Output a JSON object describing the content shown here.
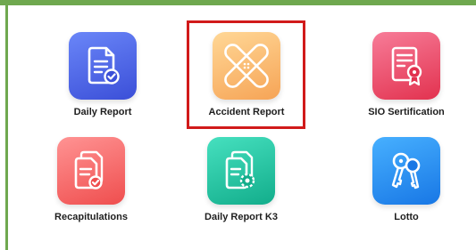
{
  "colors": {
    "frame": "#6fa84f",
    "selection": "#d11a1a"
  },
  "menu": {
    "items": [
      {
        "label": "Daily Report",
        "icon": "document-check-icon",
        "color_from": "#5f7cf6",
        "color_to": "#3b4fd8"
      },
      {
        "label": "Accident Report",
        "icon": "bandage-icon",
        "color_from": "#ffcf8a",
        "color_to": "#f7a857"
      },
      {
        "label": "SIO Sertification",
        "icon": "certificate-icon",
        "color_from": "#f4708f",
        "color_to": "#e2324f"
      },
      {
        "label": "Recapitulations",
        "icon": "documents-check-icon",
        "color_from": "#ff8a8a",
        "color_to": "#ef4e4e"
      },
      {
        "label": "Daily Report K3",
        "icon": "document-gear-icon",
        "color_from": "#3fd9b8",
        "color_to": "#13b28f"
      },
      {
        "label": "Lotto",
        "icon": "keys-icon",
        "color_from": "#3aa8ff",
        "color_to": "#1877e5"
      }
    ],
    "selected_index": 1
  }
}
